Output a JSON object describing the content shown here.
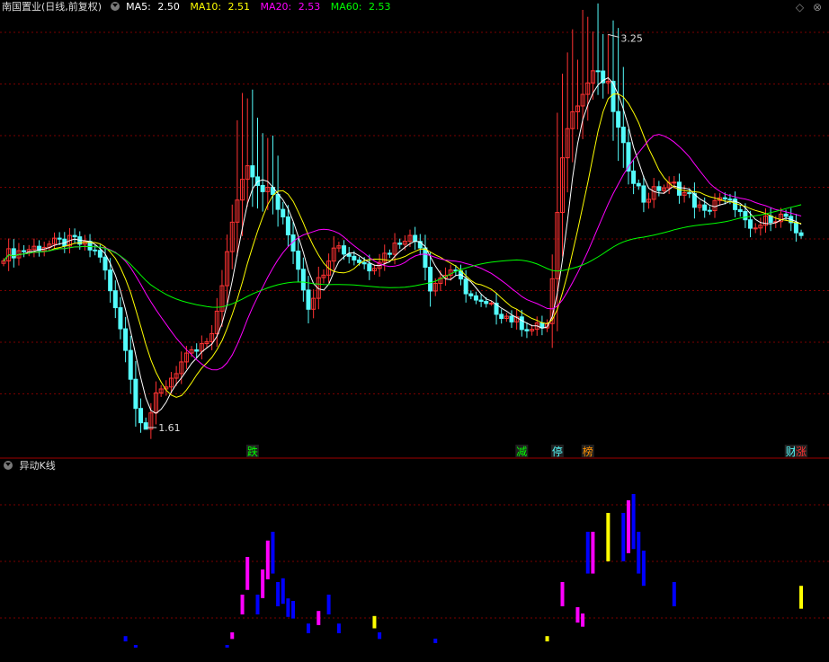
{
  "header": {
    "title": "南国置业(日线,前复权)",
    "ma5_label": "MA5:",
    "ma5_value": "2.50",
    "ma10_label": "MA10:",
    "ma10_value": "2.51",
    "ma20_label": "MA20:",
    "ma20_value": "2.53",
    "ma60_label": "MA60:",
    "ma60_value": "2.53",
    "icons": [
      "diamond-icon",
      "close-icon"
    ]
  },
  "sub_header": {
    "title": "异动K线"
  },
  "colors": {
    "up": "#ff3232",
    "down": "#54fcfc",
    "ma5": "#ffffff",
    "ma10": "#ffff00",
    "ma20": "#ff00ff",
    "ma60": "#00ff00",
    "grid": "#7a0000",
    "blue": "#0000ff",
    "magenta": "#ff00ff",
    "yellow": "#ffff00"
  },
  "chart_data": {
    "type": "candlestick",
    "high_label": "3.25",
    "low_label": "1.61",
    "ylim": [
      1.55,
      3.33
    ],
    "markers": [
      {
        "text": "跌",
        "index": 49,
        "color": "#00ff00"
      },
      {
        "text": "减",
        "index": 102,
        "color": "#00ff00"
      },
      {
        "text": "停",
        "index": 109,
        "color": "#54fcfc"
      },
      {
        "text": "榜",
        "index": 115,
        "color": "#ff9000"
      },
      {
        "text": "财",
        "index": 155,
        "color": "#54fcfc"
      },
      {
        "text": "涨",
        "index": 157,
        "color": "#ff3232"
      }
    ],
    "anchors": [
      [
        0,
        2.33
      ],
      [
        8,
        2.37
      ],
      [
        14,
        2.39
      ],
      [
        19,
        2.33
      ],
      [
        24,
        1.95
      ],
      [
        26,
        1.69
      ],
      [
        28,
        1.62
      ],
      [
        30,
        1.73
      ],
      [
        35,
        1.88
      ],
      [
        41,
        1.98
      ],
      [
        46,
        2.57
      ],
      [
        48,
        2.72
      ],
      [
        50,
        2.63
      ],
      [
        53,
        2.58
      ],
      [
        57,
        2.36
      ],
      [
        60,
        2.12
      ],
      [
        63,
        2.27
      ],
      [
        65,
        2.38
      ],
      [
        68,
        2.33
      ],
      [
        72,
        2.28
      ],
      [
        76,
        2.35
      ],
      [
        79,
        2.41
      ],
      [
        82,
        2.38
      ],
      [
        84,
        2.2
      ],
      [
        88,
        2.27
      ],
      [
        93,
        2.13
      ],
      [
        97,
        2.1
      ],
      [
        101,
        2.05
      ],
      [
        104,
        2.02
      ],
      [
        107,
        2.04
      ],
      [
        108,
        2.22
      ],
      [
        110,
        2.75
      ],
      [
        112,
        2.95
      ],
      [
        114,
        3.0
      ],
      [
        116,
        3.1
      ],
      [
        119,
        3.03
      ],
      [
        121,
        2.85
      ],
      [
        123,
        2.7
      ],
      [
        126,
        2.56
      ],
      [
        129,
        2.61
      ],
      [
        132,
        2.62
      ],
      [
        135,
        2.57
      ],
      [
        138,
        2.5
      ],
      [
        140,
        2.56
      ],
      [
        144,
        2.54
      ],
      [
        147,
        2.42
      ],
      [
        151,
        2.49
      ],
      [
        154,
        2.49
      ],
      [
        156,
        2.4
      ],
      [
        157,
        2.41
      ]
    ],
    "series_lines": [
      {
        "name": "MA5",
        "value": 2.5
      },
      {
        "name": "MA10",
        "value": 2.51
      },
      {
        "name": "MA20",
        "value": 2.53
      },
      {
        "name": "MA60",
        "value": 2.53
      }
    ],
    "indicator": {
      "name": "异动K线",
      "bars": [
        {
          "i": 24,
          "v": 0.12,
          "c": "blue"
        },
        {
          "i": 26,
          "v": 0.05,
          "c": "blue"
        },
        {
          "i": 44,
          "v": 0.05,
          "c": "blue"
        },
        {
          "i": 45,
          "v": 0.15,
          "c": "magenta"
        },
        {
          "i": 47,
          "v": 0.45,
          "c": "magenta"
        },
        {
          "i": 48,
          "v": 0.75,
          "c": "magenta"
        },
        {
          "i": 50,
          "v": 0.45,
          "c": "blue"
        },
        {
          "i": 51,
          "v": 0.65,
          "c": "magenta"
        },
        {
          "i": 52,
          "v": 0.88,
          "c": "magenta"
        },
        {
          "i": 53,
          "v": 0.95,
          "c": "blue"
        },
        {
          "i": 54,
          "v": 0.55,
          "c": "blue"
        },
        {
          "i": 55,
          "v": 0.58,
          "c": "blue"
        },
        {
          "i": 56,
          "v": 0.42,
          "c": "blue"
        },
        {
          "i": 57,
          "v": 0.4,
          "c": "blue"
        },
        {
          "i": 60,
          "v": 0.22,
          "c": "blue"
        },
        {
          "i": 62,
          "v": 0.32,
          "c": "magenta"
        },
        {
          "i": 64,
          "v": 0.45,
          "c": "blue"
        },
        {
          "i": 66,
          "v": 0.22,
          "c": "blue"
        },
        {
          "i": 73,
          "v": 0.28,
          "c": "yellow"
        },
        {
          "i": 74,
          "v": 0.15,
          "c": "blue"
        },
        {
          "i": 85,
          "v": 0.1,
          "c": "blue"
        },
        {
          "i": 107,
          "v": 0.12,
          "c": "yellow"
        },
        {
          "i": 110,
          "v": 0.55,
          "c": "magenta"
        },
        {
          "i": 113,
          "v": 0.35,
          "c": "magenta"
        },
        {
          "i": 114,
          "v": 0.3,
          "c": "magenta"
        },
        {
          "i": 115,
          "v": 0.95,
          "c": "blue"
        },
        {
          "i": 116,
          "v": 0.95,
          "c": "magenta"
        },
        {
          "i": 119,
          "v": 1.1,
          "c": "yellow"
        },
        {
          "i": 122,
          "v": 1.1,
          "c": "blue"
        },
        {
          "i": 123,
          "v": 1.2,
          "c": "magenta"
        },
        {
          "i": 124,
          "v": 1.25,
          "c": "blue"
        },
        {
          "i": 125,
          "v": 0.95,
          "c": "blue"
        },
        {
          "i": 126,
          "v": 0.8,
          "c": "blue"
        },
        {
          "i": 132,
          "v": 0.55,
          "c": "blue"
        },
        {
          "i": 157,
          "v": 0.52,
          "c": "yellow"
        }
      ]
    }
  }
}
